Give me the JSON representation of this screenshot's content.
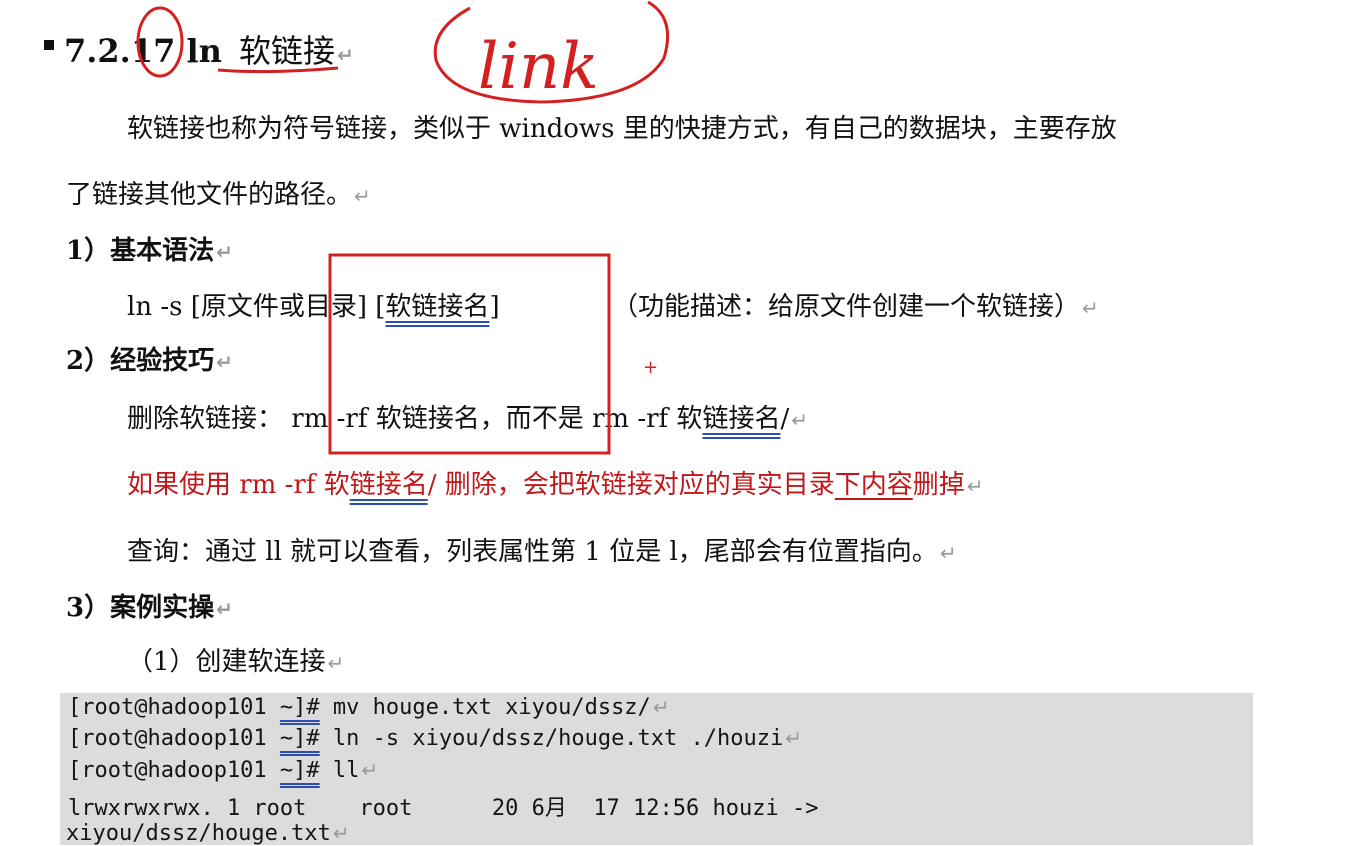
{
  "heading": {
    "number": "7.2.17 ln",
    "title": "软链接",
    "return_mark": "↵"
  },
  "annotation": {
    "handwritten_word": "link",
    "plus_mark": "+"
  },
  "intro": {
    "line1": "软链接也称为符号链接，类似于 windows 里的快捷方式，有自己的数据块，主要存放",
    "line2": "了链接其他文件的路径。"
  },
  "section1": {
    "title": "1）基本语法",
    "syntax_prefix": "ln -s [原文件或目录] [",
    "syntax_underlined": "软链接名",
    "syntax_suffix": "]",
    "description": "（功能描述：给原文件创建一个软链接）"
  },
  "section2": {
    "title": "2）经验技巧",
    "tip1_prefix": "删除软链接：  rm -rf 软链接名，而不是 rm -rf 软",
    "tip1_underlined": "链接名",
    "tip1_suffix": "/",
    "warning_prefix": "如果使用 rm -rf 软",
    "warning_underlined1": "链接名",
    "warning_mid": "/  删除，会把软链接对应的真实目录",
    "warning_underlined2": "下内容",
    "warning_suffix": "删掉",
    "query": "查询：通过 ll 就可以查看，列表属性第 1 位是 l，尾部会有位置指向。"
  },
  "section3": {
    "title": "3）案例实操",
    "sub1": "（1）创建软连接"
  },
  "code": {
    "prompt": "[root@hadoop101 ",
    "prompt_dir": "~]#",
    "cmd1": " mv houge.txt xiyou/dssz/",
    "cmd2": " ln -s xiyou/dssz/houge.txt ./houzi",
    "cmd3": " ll",
    "output1": "lrwxrwxrwx. 1 root    root      20 6月  17 12:56 houzi ->",
    "output2": "xiyou/dssz/houge.txt"
  },
  "colors": {
    "annotation_red": "#d42020",
    "code_bg": "#dcdcdc",
    "warning_red": "#c0181a"
  }
}
